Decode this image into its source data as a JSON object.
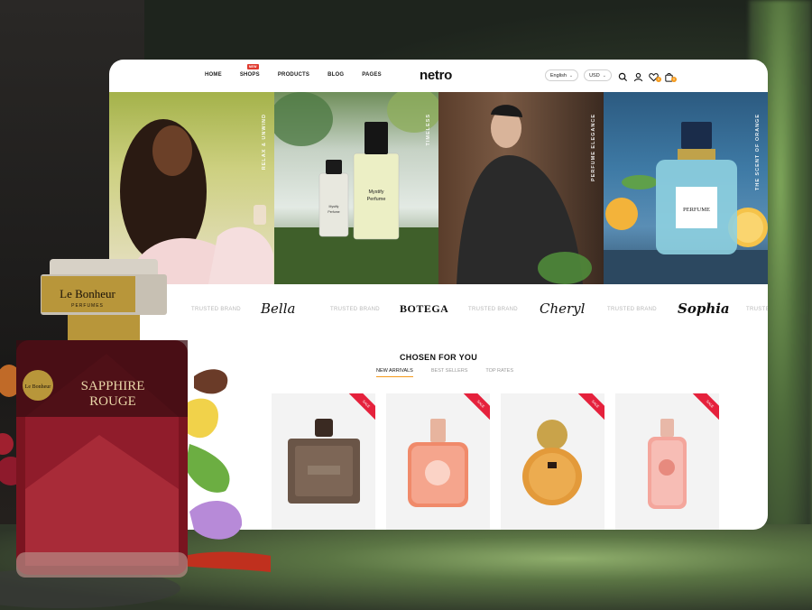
{
  "nav": {
    "links": [
      "HOME",
      "SHOPS",
      "PRODUCTS",
      "BLOG",
      "PAGES"
    ],
    "new_badge": "NEW",
    "logo": "netro",
    "language": "English",
    "currency": "USD",
    "wishlist_count": "0",
    "cart_count": "0"
  },
  "hero_tiles": [
    {
      "label": "RELAX & UNWIND"
    },
    {
      "label": "TIMELESS",
      "bottle_text": "Mystify Perfume",
      "small_bottle_text": "Mystify Perfume"
    },
    {
      "label": "PERFUME ELEGANCE"
    },
    {
      "label": "THE SCENT OF ORANGE",
      "bottle_text": "PERFUME"
    }
  ],
  "brands": {
    "trusted": "TRUSTED BRAND",
    "names": [
      "Bella",
      "BOTEGA",
      "Cheryl",
      "Sophia"
    ]
  },
  "section": {
    "title": "CHOSEN FOR YOU",
    "tabs": [
      "NEW ARRIVALS",
      "BEST SELLERS",
      "TOP RATES"
    ],
    "active_tab": "NEW ARRIVALS"
  },
  "products": [
    {
      "badge": "SALE"
    },
    {
      "badge": "SALE"
    },
    {
      "badge": "SALE"
    },
    {
      "badge": "SALE"
    }
  ],
  "showcase_bottle": {
    "brand": "Le Bonheur",
    "brand_sub": "PERFUMES",
    "seal": "Le Bonheur",
    "name_line1": "SAPPHIRE",
    "name_line2": "ROUGE"
  },
  "colors": {
    "accent": "#f59a1c",
    "sale_red": "#e5213c",
    "new_badge": "#e03a2f"
  }
}
